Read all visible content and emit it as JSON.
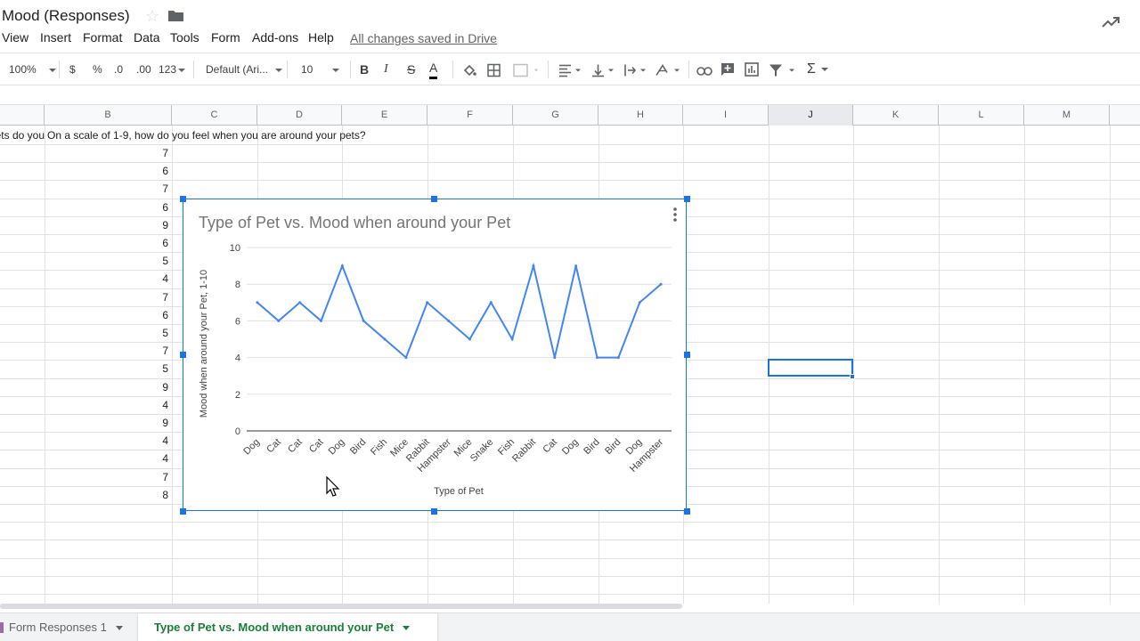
{
  "document": {
    "title": "Mood (Responses)",
    "save_status": "All changes saved in Drive"
  },
  "menu": {
    "items": [
      "View",
      "Insert",
      "Format",
      "Data",
      "Tools",
      "Form",
      "Add-ons",
      "Help"
    ]
  },
  "toolbar": {
    "zoom": "100%",
    "currency": "$",
    "percent": "%",
    "decrease_decimal": ".0",
    "increase_decimal": ".00",
    "more_formats": "123",
    "font": "Default (Ari...",
    "font_size": "10",
    "bold": "B",
    "italic": "I",
    "strike": "S",
    "text_color": "A",
    "sum": "Σ"
  },
  "columns": [
    "B",
    "C",
    "D",
    "E",
    "F",
    "G",
    "H",
    "I",
    "J",
    "K",
    "L",
    "M"
  ],
  "selected_column": "J",
  "sheet": {
    "header_a_fragment": "ets do you",
    "header_b": "On a scale of 1-9, how do you feel when you are around your pets?",
    "column_b_values": [
      "7",
      "6",
      "7",
      "6",
      "9",
      "6",
      "5",
      "4",
      "7",
      "6",
      "5",
      "7",
      "5",
      "9",
      "4",
      "9",
      "4",
      "4",
      "7",
      "8"
    ]
  },
  "chart_data": {
    "type": "line",
    "title": "Type of Pet vs. Mood when around your Pet",
    "xlabel": "Type of Pet",
    "ylabel": "Mood when around your Pet, 1-10",
    "ylim": [
      0,
      10
    ],
    "yticks": [
      "0",
      "2",
      "4",
      "6",
      "8",
      "10"
    ],
    "categories": [
      "Dog",
      "Cat",
      "Cat",
      "Cat",
      "Dog",
      "Bird",
      "Fish",
      "Mice",
      "Rabbit",
      "Hampster",
      "Mice",
      "Snake",
      "Fish",
      "Rabbit",
      "Cat",
      "Dog",
      "Bird",
      "Bird",
      "Dog",
      "Hampster"
    ],
    "values": [
      7,
      6,
      7,
      6,
      9,
      6,
      5,
      4,
      7,
      6,
      5,
      7,
      5,
      9,
      4,
      9,
      4,
      4,
      7,
      8
    ],
    "grid": true,
    "line_color": "#4285f4"
  },
  "sheet_tabs": {
    "tab1": "Form Responses 1",
    "tab2": "Type of Pet  vs.  Mood when around your Pet"
  },
  "colors": {
    "selection": "#1a73e8",
    "active_tab_text": "#188038"
  }
}
